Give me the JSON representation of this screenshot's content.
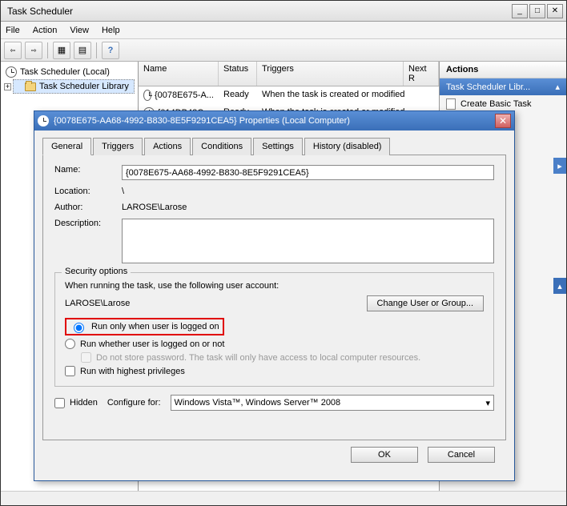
{
  "window": {
    "title": "Task Scheduler"
  },
  "menubar": {
    "file": "File",
    "action": "Action",
    "view": "View",
    "help": "Help"
  },
  "tree": {
    "root": "Task Scheduler (Local)",
    "library": "Task Scheduler Library"
  },
  "list": {
    "columns": {
      "name": "Name",
      "status": "Status",
      "triggers": "Triggers",
      "next": "Next R"
    },
    "rows": [
      {
        "name": "{0078E675-A...",
        "status": "Ready",
        "triggers": "When the task is created or modified"
      },
      {
        "name": "{014DB42C-...",
        "status": "Ready",
        "triggers": "When the task is created or modified"
      }
    ]
  },
  "actions": {
    "header": "Actions",
    "group": "Task Scheduler Libr...",
    "create_basic": "Create Basic Task"
  },
  "dialog": {
    "title": "{0078E675-AA68-4992-B830-8E5F9291CEA5} Properties (Local Computer)",
    "tabs": {
      "general": "General",
      "triggers": "Triggers",
      "actions": "Actions",
      "conditions": "Conditions",
      "settings": "Settings",
      "history": "History (disabled)"
    },
    "fields": {
      "name_label": "Name:",
      "name_value": "{0078E675-AA68-4992-B830-8E5F9291CEA5}",
      "location_label": "Location:",
      "location_value": "\\",
      "author_label": "Author:",
      "author_value": "LAROSE\\Larose",
      "description_label": "Description:",
      "description_value": ""
    },
    "security": {
      "legend": "Security options",
      "prompt": "When running the task, use the following user account:",
      "account": "LAROSE\\Larose",
      "change_btn": "Change User or Group...",
      "radio_logged_on": "Run only when user is logged on",
      "radio_whether": "Run whether user is logged on or not",
      "no_store": "Do not store password.  The task will only have access to local computer resources.",
      "highest": "Run with highest privileges"
    },
    "bottom": {
      "hidden": "Hidden",
      "configure_label": "Configure for:",
      "configure_value": "Windows Vista™, Windows Server™ 2008"
    },
    "buttons": {
      "ok": "OK",
      "cancel": "Cancel"
    }
  }
}
